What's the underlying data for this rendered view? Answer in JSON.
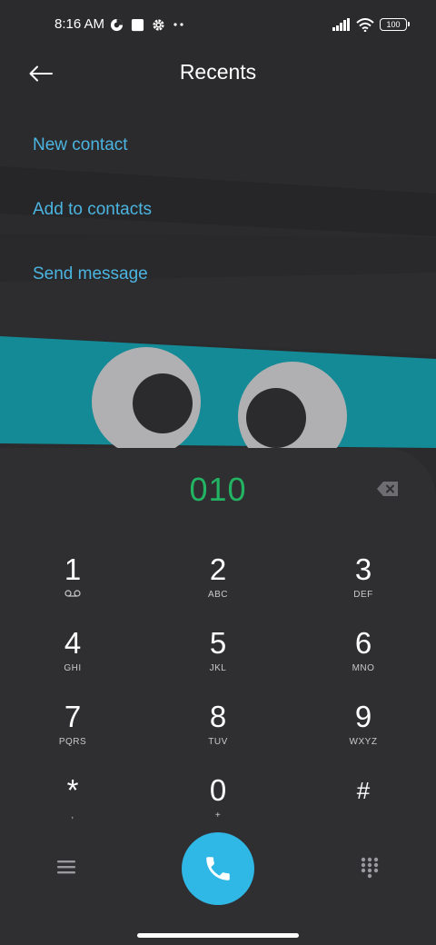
{
  "status_bar": {
    "time": "8:16 AM",
    "battery": "100",
    "icons_left": [
      "data-saver-icon",
      "square-icon",
      "gear-icon",
      "more-dots-icon"
    ],
    "icons_right": [
      "signal-icon",
      "wifi-icon",
      "battery-icon"
    ]
  },
  "header": {
    "back_icon": "arrow-left-icon",
    "title": "Recents"
  },
  "actions": {
    "new_contact": "New contact",
    "add_to_contacts": "Add to contacts",
    "send_message": "Send message"
  },
  "dialer": {
    "number": "010",
    "backspace_icon": "backspace-icon",
    "keys": [
      {
        "digit": "1",
        "letters": "",
        "sub_icon": "voicemail-icon"
      },
      {
        "digit": "2",
        "letters": "ABC"
      },
      {
        "digit": "3",
        "letters": "DEF"
      },
      {
        "digit": "4",
        "letters": "GHI"
      },
      {
        "digit": "5",
        "letters": "JKL"
      },
      {
        "digit": "6",
        "letters": "MNO"
      },
      {
        "digit": "7",
        "letters": "PQRS"
      },
      {
        "digit": "8",
        "letters": "TUV"
      },
      {
        "digit": "9",
        "letters": "WXYZ"
      },
      {
        "digit": "*",
        "letters": ","
      },
      {
        "digit": "0",
        "letters": "+"
      },
      {
        "digit": "#",
        "letters": ""
      }
    ],
    "menu_icon": "hamburger-menu-icon",
    "call_icon": "phone-icon",
    "keypad_icon": "dialpad-icon"
  },
  "colors": {
    "accent": "#4bb4e0",
    "number_green": "#22b463",
    "call_button": "#2fb8e6",
    "background": "#2b2b2d"
  }
}
